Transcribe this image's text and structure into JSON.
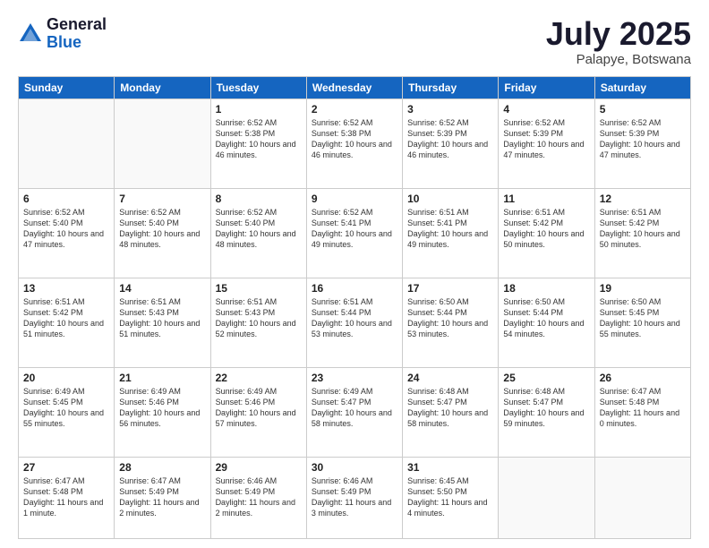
{
  "header": {
    "logo_general": "General",
    "logo_blue": "Blue",
    "month_title": "July 2025",
    "location": "Palapye, Botswana"
  },
  "days_of_week": [
    "Sunday",
    "Monday",
    "Tuesday",
    "Wednesday",
    "Thursday",
    "Friday",
    "Saturday"
  ],
  "weeks": [
    [
      {
        "day": "",
        "info": ""
      },
      {
        "day": "",
        "info": ""
      },
      {
        "day": "1",
        "info": "Sunrise: 6:52 AM\nSunset: 5:38 PM\nDaylight: 10 hours and 46 minutes."
      },
      {
        "day": "2",
        "info": "Sunrise: 6:52 AM\nSunset: 5:38 PM\nDaylight: 10 hours and 46 minutes."
      },
      {
        "day": "3",
        "info": "Sunrise: 6:52 AM\nSunset: 5:39 PM\nDaylight: 10 hours and 46 minutes."
      },
      {
        "day": "4",
        "info": "Sunrise: 6:52 AM\nSunset: 5:39 PM\nDaylight: 10 hours and 47 minutes."
      },
      {
        "day": "5",
        "info": "Sunrise: 6:52 AM\nSunset: 5:39 PM\nDaylight: 10 hours and 47 minutes."
      }
    ],
    [
      {
        "day": "6",
        "info": "Sunrise: 6:52 AM\nSunset: 5:40 PM\nDaylight: 10 hours and 47 minutes."
      },
      {
        "day": "7",
        "info": "Sunrise: 6:52 AM\nSunset: 5:40 PM\nDaylight: 10 hours and 48 minutes."
      },
      {
        "day": "8",
        "info": "Sunrise: 6:52 AM\nSunset: 5:40 PM\nDaylight: 10 hours and 48 minutes."
      },
      {
        "day": "9",
        "info": "Sunrise: 6:52 AM\nSunset: 5:41 PM\nDaylight: 10 hours and 49 minutes."
      },
      {
        "day": "10",
        "info": "Sunrise: 6:51 AM\nSunset: 5:41 PM\nDaylight: 10 hours and 49 minutes."
      },
      {
        "day": "11",
        "info": "Sunrise: 6:51 AM\nSunset: 5:42 PM\nDaylight: 10 hours and 50 minutes."
      },
      {
        "day": "12",
        "info": "Sunrise: 6:51 AM\nSunset: 5:42 PM\nDaylight: 10 hours and 50 minutes."
      }
    ],
    [
      {
        "day": "13",
        "info": "Sunrise: 6:51 AM\nSunset: 5:42 PM\nDaylight: 10 hours and 51 minutes."
      },
      {
        "day": "14",
        "info": "Sunrise: 6:51 AM\nSunset: 5:43 PM\nDaylight: 10 hours and 51 minutes."
      },
      {
        "day": "15",
        "info": "Sunrise: 6:51 AM\nSunset: 5:43 PM\nDaylight: 10 hours and 52 minutes."
      },
      {
        "day": "16",
        "info": "Sunrise: 6:51 AM\nSunset: 5:44 PM\nDaylight: 10 hours and 53 minutes."
      },
      {
        "day": "17",
        "info": "Sunrise: 6:50 AM\nSunset: 5:44 PM\nDaylight: 10 hours and 53 minutes."
      },
      {
        "day": "18",
        "info": "Sunrise: 6:50 AM\nSunset: 5:44 PM\nDaylight: 10 hours and 54 minutes."
      },
      {
        "day": "19",
        "info": "Sunrise: 6:50 AM\nSunset: 5:45 PM\nDaylight: 10 hours and 55 minutes."
      }
    ],
    [
      {
        "day": "20",
        "info": "Sunrise: 6:49 AM\nSunset: 5:45 PM\nDaylight: 10 hours and 55 minutes."
      },
      {
        "day": "21",
        "info": "Sunrise: 6:49 AM\nSunset: 5:46 PM\nDaylight: 10 hours and 56 minutes."
      },
      {
        "day": "22",
        "info": "Sunrise: 6:49 AM\nSunset: 5:46 PM\nDaylight: 10 hours and 57 minutes."
      },
      {
        "day": "23",
        "info": "Sunrise: 6:49 AM\nSunset: 5:47 PM\nDaylight: 10 hours and 58 minutes."
      },
      {
        "day": "24",
        "info": "Sunrise: 6:48 AM\nSunset: 5:47 PM\nDaylight: 10 hours and 58 minutes."
      },
      {
        "day": "25",
        "info": "Sunrise: 6:48 AM\nSunset: 5:47 PM\nDaylight: 10 hours and 59 minutes."
      },
      {
        "day": "26",
        "info": "Sunrise: 6:47 AM\nSunset: 5:48 PM\nDaylight: 11 hours and 0 minutes."
      }
    ],
    [
      {
        "day": "27",
        "info": "Sunrise: 6:47 AM\nSunset: 5:48 PM\nDaylight: 11 hours and 1 minute."
      },
      {
        "day": "28",
        "info": "Sunrise: 6:47 AM\nSunset: 5:49 PM\nDaylight: 11 hours and 2 minutes."
      },
      {
        "day": "29",
        "info": "Sunrise: 6:46 AM\nSunset: 5:49 PM\nDaylight: 11 hours and 2 minutes."
      },
      {
        "day": "30",
        "info": "Sunrise: 6:46 AM\nSunset: 5:49 PM\nDaylight: 11 hours and 3 minutes."
      },
      {
        "day": "31",
        "info": "Sunrise: 6:45 AM\nSunset: 5:50 PM\nDaylight: 11 hours and 4 minutes."
      },
      {
        "day": "",
        "info": ""
      },
      {
        "day": "",
        "info": ""
      }
    ]
  ]
}
